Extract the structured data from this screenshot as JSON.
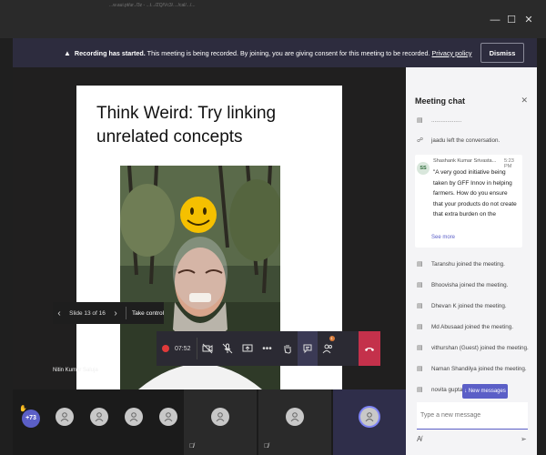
{
  "window": {
    "url_strip": "...w.aui.pt/ur../3z - ...t.../ZQ/Vc3/..../cal/.../...",
    "minimize": "—",
    "maximize": "☐",
    "close": "✕"
  },
  "banner": {
    "title": "Recording has started.",
    "message": " This meeting is being recorded. By joining, you are giving consent for this meeting to be recorded. ",
    "link": "Privacy policy",
    "dismiss": "Dismiss"
  },
  "slide": {
    "title": "Think Weird: Try linking unrelated concepts",
    "presenter": "Nitin Kumar Saluja",
    "nav_counter": "Slide 13 of 16",
    "take_control": "Take control"
  },
  "controls": {
    "timer": "07:52",
    "badge_count": "1"
  },
  "chat": {
    "title": "Meeting chat",
    "events_top": [
      {
        "icon": "☍",
        "text": "jaadu left the conversation."
      }
    ],
    "message": {
      "initials": "SS",
      "sender": "Shashank Kumar Srivasta...",
      "time": "5:23 PM",
      "text": "\"A very good initiative being taken by GFF Innov in helping farmers. How do you ensure that your products do not create that extra burden on the",
      "see_more": "See more"
    },
    "events": [
      {
        "text": "Taranshu joined the meeting."
      },
      {
        "text": "Bhoovisha joined the meeting."
      },
      {
        "text": "Dhevan K joined the meeting."
      },
      {
        "text": "Md Abusaad joined the meeting."
      },
      {
        "text": "vithurshan (Guest) joined the meeting."
      },
      {
        "text": "Naman Shandilya joined the meeting."
      },
      {
        "text": "novita gupta"
      }
    ],
    "new_messages": "↓ New messages",
    "compose_placeholder": "Type a new message"
  },
  "roster": {
    "more_count": "+73"
  }
}
